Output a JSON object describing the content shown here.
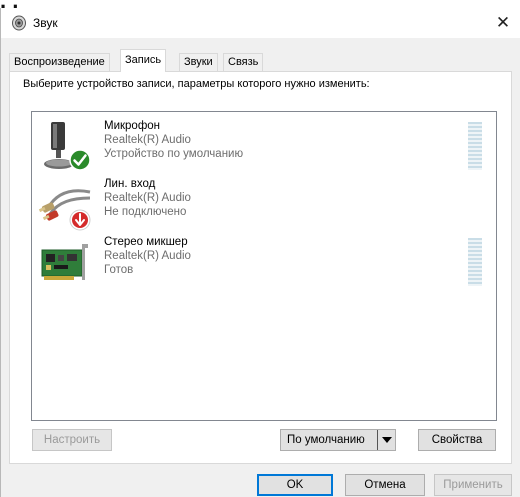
{
  "background_text": "  .   ,       ",
  "window": {
    "title": "Звук",
    "close_glyph": "✕"
  },
  "tabs": [
    {
      "label": "Воспроизведение",
      "active": false
    },
    {
      "label": "Запись",
      "active": true
    },
    {
      "label": "Звуки",
      "active": false
    },
    {
      "label": "Связь",
      "active": false
    }
  ],
  "instruction": "Выберите устройство записи, параметры которого нужно изменить:",
  "devices": [
    {
      "name": "Микрофон",
      "driver": "Realtek(R) Audio",
      "status": "Устройство по умолчанию",
      "icon": "microphone-icon",
      "badge": "default-check",
      "meter": true
    },
    {
      "name": "Лин. вход",
      "driver": "Realtek(R) Audio",
      "status": "Не подключено",
      "icon": "line-in-cable-icon",
      "badge": "not-connected-arrow",
      "meter": false
    },
    {
      "name": "Стерео микшер",
      "driver": "Realtek(R) Audio",
      "status": "Готов",
      "icon": "sound-card-icon",
      "badge": "none",
      "meter": true
    }
  ],
  "buttons": {
    "configure": "Настроить",
    "set_default": "По умолчанию",
    "properties": "Свойства",
    "ok": "OK",
    "cancel": "Отмена",
    "apply": "Применить"
  },
  "colors": {
    "check_badge": "#2a8a2a",
    "arrow_badge": "#d42b2b",
    "accent": "#0078d7"
  }
}
